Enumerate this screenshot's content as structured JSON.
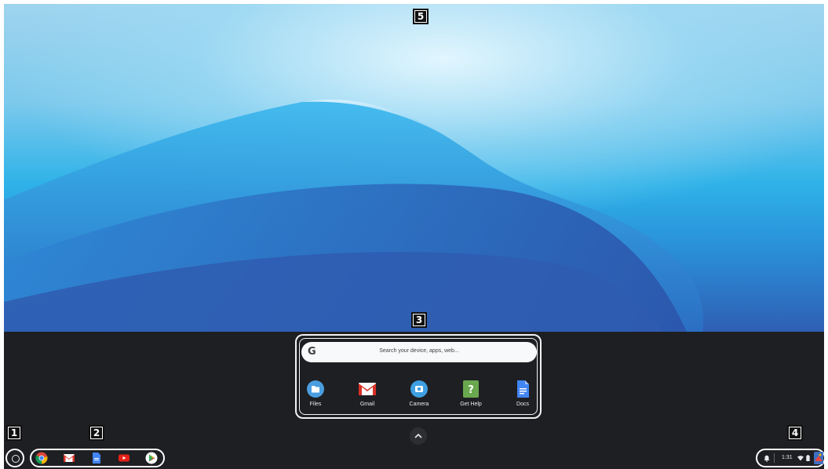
{
  "annotations": {
    "badge_1": "1",
    "badge_2": "2",
    "badge_3": "3",
    "badge_4": "4",
    "badge_5": "5"
  },
  "launcher": {
    "search_g": "G",
    "search_placeholder": "Search your device, apps, web...",
    "apps": [
      {
        "label": "Files",
        "icon": "files-icon",
        "color": "#4a9ee0"
      },
      {
        "label": "Gmail",
        "icon": "gmail-icon",
        "color": "#d93025"
      },
      {
        "label": "Camera",
        "icon": "camera-icon",
        "color": "#3ea0e0"
      },
      {
        "label": "Get Help",
        "icon": "get-help-icon",
        "color": "#6aa84f"
      },
      {
        "label": "Docs",
        "icon": "docs-icon",
        "color": "#4285f4"
      }
    ]
  },
  "shelf": {
    "pinned_apps": [
      "chrome-icon",
      "gmail-icon",
      "docs-icon",
      "youtube-icon",
      "play-store-icon"
    ]
  },
  "status_tray": {
    "time": "1:31"
  },
  "colors": {
    "shelf_background": "#1e1f22",
    "wallpaper_top": "#9fd4ee",
    "wallpaper_bottom": "#2f5fb4"
  }
}
